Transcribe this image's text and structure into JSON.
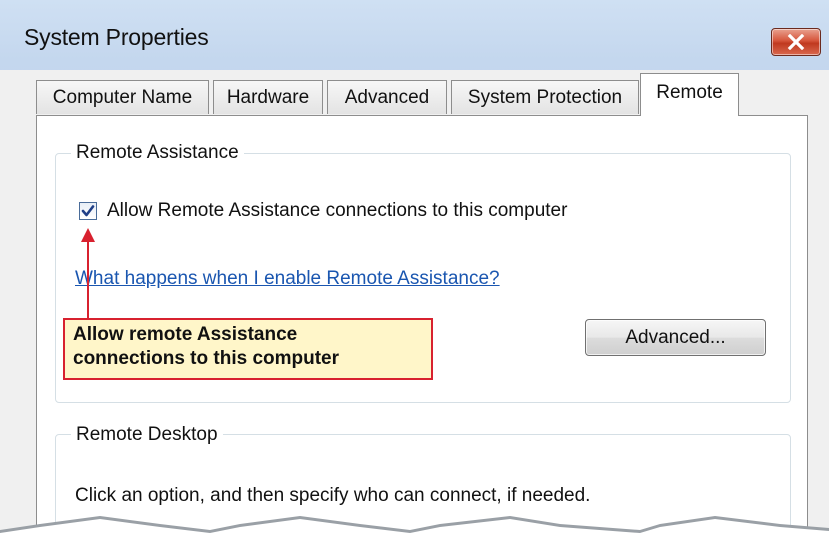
{
  "window": {
    "title": "System Properties"
  },
  "tabs": [
    {
      "label": "Computer Name",
      "active": false
    },
    {
      "label": "Hardware",
      "active": false
    },
    {
      "label": "Advanced",
      "active": false
    },
    {
      "label": "System Protection",
      "active": false
    },
    {
      "label": "Remote",
      "active": true
    }
  ],
  "remote_assistance": {
    "group_title": "Remote Assistance",
    "allow_checkbox_label": "Allow Remote Assistance connections to this computer",
    "allow_checked": true,
    "help_link": "What happens when I enable Remote Assistance?",
    "advanced_button": "Advanced..."
  },
  "callout": {
    "line1": "Allow remote Assistance",
    "line2": "connections to this computer"
  },
  "remote_desktop": {
    "group_title": "Remote Desktop",
    "instruction": "Click an option, and then specify who can connect, if needed."
  },
  "colors": {
    "title_bar": "#c4d7ee",
    "callout_border": "#d8212f",
    "callout_fill": "#fff6c9",
    "link": "#1a56b0",
    "close_button": "#c0391f"
  }
}
